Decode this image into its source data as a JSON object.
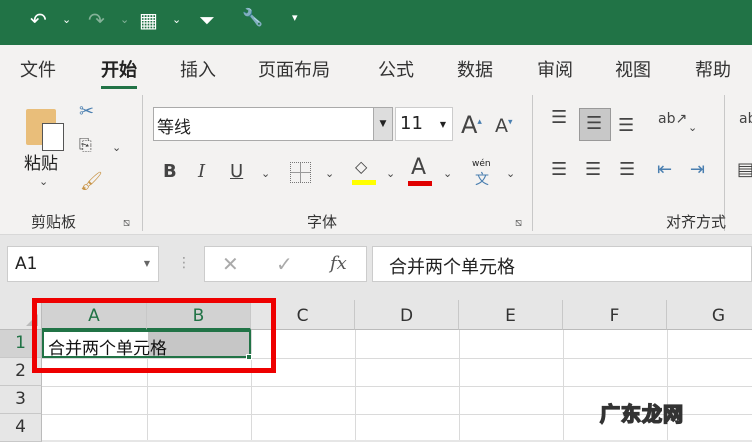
{
  "quick_access": {
    "undo_icon": "undo-icon",
    "redo_icon": "redo-icon",
    "format_icon": "table-format-icon",
    "filter_icon": "filter-icon",
    "tools_icon": "tools-icon",
    "customize_icon": "customize-icon"
  },
  "tabs": [
    {
      "label": "文件"
    },
    {
      "label": "开始",
      "active": true
    },
    {
      "label": "插入"
    },
    {
      "label": "页面布局"
    },
    {
      "label": "公式"
    },
    {
      "label": "数据"
    },
    {
      "label": "审阅"
    },
    {
      "label": "视图"
    },
    {
      "label": "帮助"
    }
  ],
  "ribbon": {
    "clipboard": {
      "paste_label": "粘贴",
      "group_label": "剪贴板"
    },
    "font": {
      "font_name": "等线",
      "font_size": "11",
      "bold": "B",
      "italic": "I",
      "underline": "U",
      "font_color_glyph": "A",
      "phonetic_top": "wén",
      "phonetic_bottom": "文",
      "group_label": "字体"
    },
    "alignment": {
      "group_label": "对齐方式"
    },
    "accent_color": "#217346",
    "highlight_color": "#ffff00",
    "font_color": "#e00000"
  },
  "formula_bar": {
    "name_box": "A1",
    "fx": "fx",
    "cancel": "✕",
    "enter": "✓",
    "content": "合并两个单元格"
  },
  "sheet": {
    "columns": [
      "A",
      "B",
      "C",
      "D",
      "E",
      "F",
      "G"
    ],
    "rows": [
      "1",
      "2",
      "3",
      "4"
    ],
    "cell_A1": "合并两个单元格"
  },
  "watermark": "广东龙网"
}
